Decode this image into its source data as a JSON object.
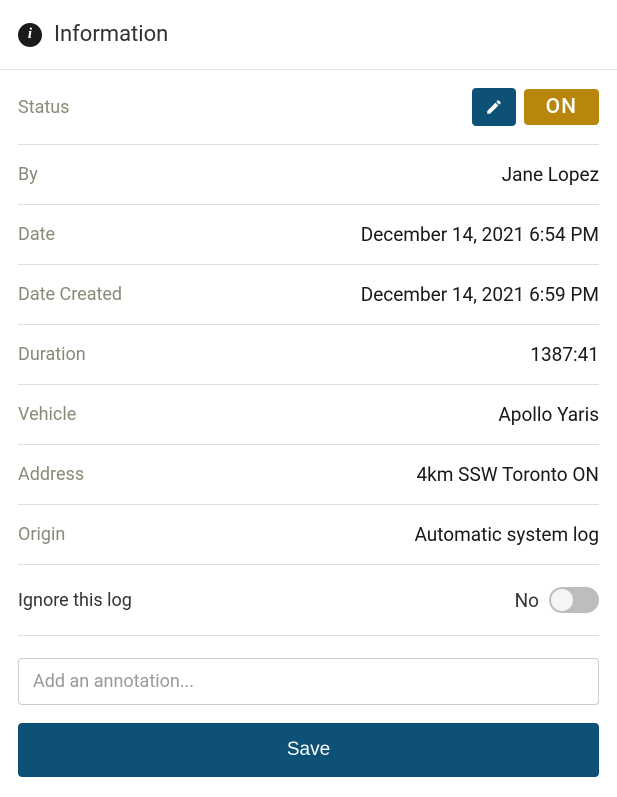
{
  "header": {
    "title": "Information"
  },
  "fields": {
    "status": {
      "label": "Status",
      "value": "ON"
    },
    "by": {
      "label": "By",
      "value": "Jane Lopez"
    },
    "date": {
      "label": "Date",
      "value": "December 14, 2021 6:54 PM"
    },
    "dateCreated": {
      "label": "Date Created",
      "value": "December 14, 2021 6:59 PM"
    },
    "duration": {
      "label": "Duration",
      "value": "1387:41"
    },
    "vehicle": {
      "label": "Vehicle",
      "value": "Apollo Yaris"
    },
    "address": {
      "label": "Address",
      "value": "4km SSW Toronto ON"
    },
    "origin": {
      "label": "Origin",
      "value": "Automatic system log"
    },
    "ignore": {
      "label": "Ignore this log",
      "value": "No"
    }
  },
  "annotation": {
    "placeholder": "Add an annotation..."
  },
  "actions": {
    "save": "Save"
  }
}
